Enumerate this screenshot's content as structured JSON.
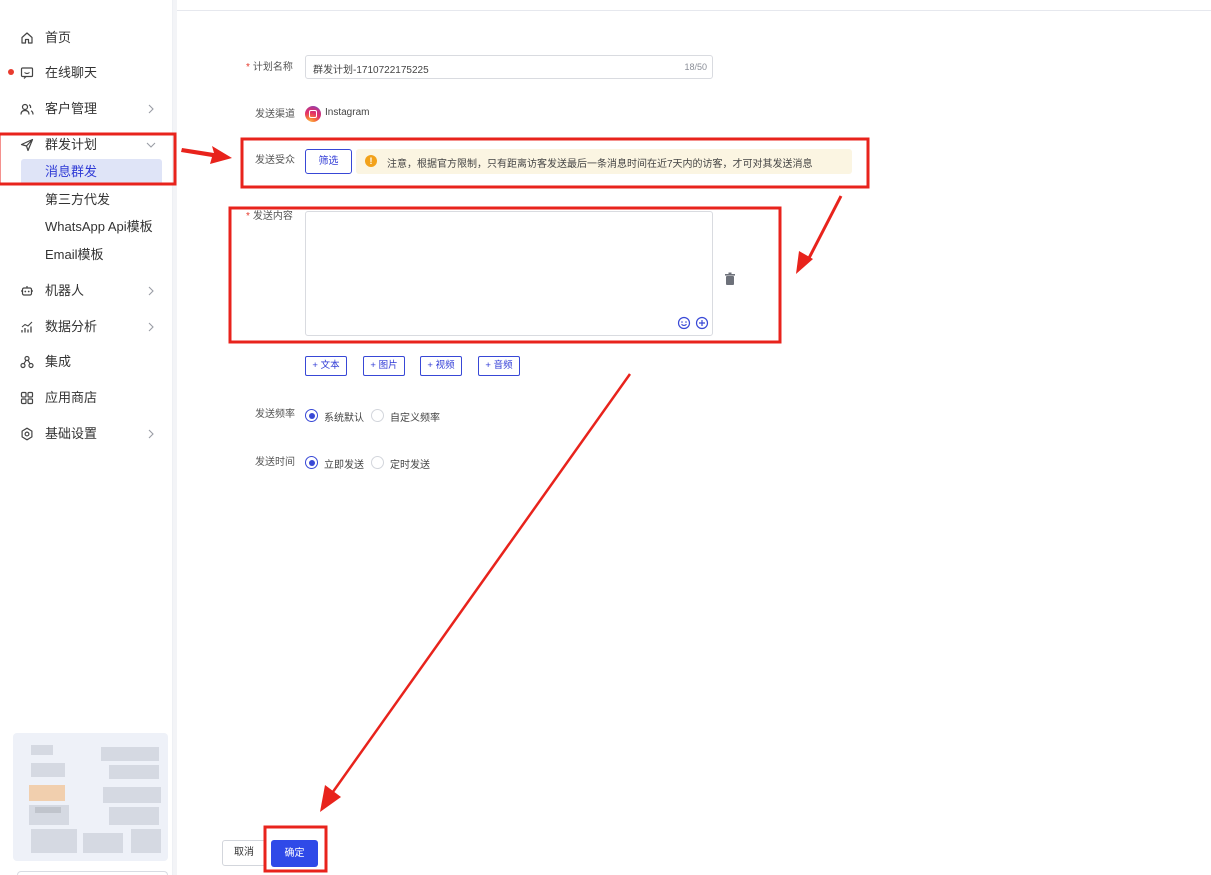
{
  "sidebar": {
    "items": [
      {
        "label": "首页",
        "icon": "home-icon"
      },
      {
        "label": "在线聊天",
        "icon": "chat-icon"
      },
      {
        "label": "客户管理",
        "icon": "users-icon"
      },
      {
        "label": "群发计划",
        "icon": "send-icon"
      },
      {
        "label": "机器人",
        "icon": "robot-icon"
      },
      {
        "label": "数据分析",
        "icon": "analytics-icon"
      },
      {
        "label": "集成",
        "icon": "integration-icon"
      },
      {
        "label": "应用商店",
        "icon": "app-store-icon"
      },
      {
        "label": "基础设置",
        "icon": "settings-icon"
      }
    ],
    "subitems": [
      {
        "label": "消息群发",
        "active": true
      },
      {
        "label": "第三方代发"
      },
      {
        "label": "WhatsApp Api模板"
      },
      {
        "label": "Email模板"
      }
    ]
  },
  "form": {
    "required_mark": "*",
    "plan_name_label": "计划名称",
    "plan_name_value": "群发计划-1710722175225",
    "plan_name_count": "18/50",
    "channel_label": "发送渠道",
    "channel_value": "Instagram",
    "audience_label": "发送受众",
    "filter_button": "筛选",
    "warning_icon_char": "!",
    "notice": "注意，根据官方限制，只有距离访客发送最后一条消息时间在近7天内的访客，才可对其发送消息",
    "content_label": "发送内容",
    "add_text": "+ 文本",
    "add_image": "+ 图片",
    "add_video": "+ 视频",
    "add_audio": "+ 音频",
    "frequency_label": "发送频率",
    "frequency_options": [
      "系统默认",
      "自定义频率"
    ],
    "time_label": "发送时间",
    "time_options": [
      "立即发送",
      "定时发送"
    ],
    "cancel_button": "取消",
    "confirm_button": "确定"
  },
  "colors": {
    "accent": "#2f4ae8",
    "annotation_red": "#e8231c",
    "notice_bg": "#fbf5e2",
    "warning": "#f2a21b"
  }
}
